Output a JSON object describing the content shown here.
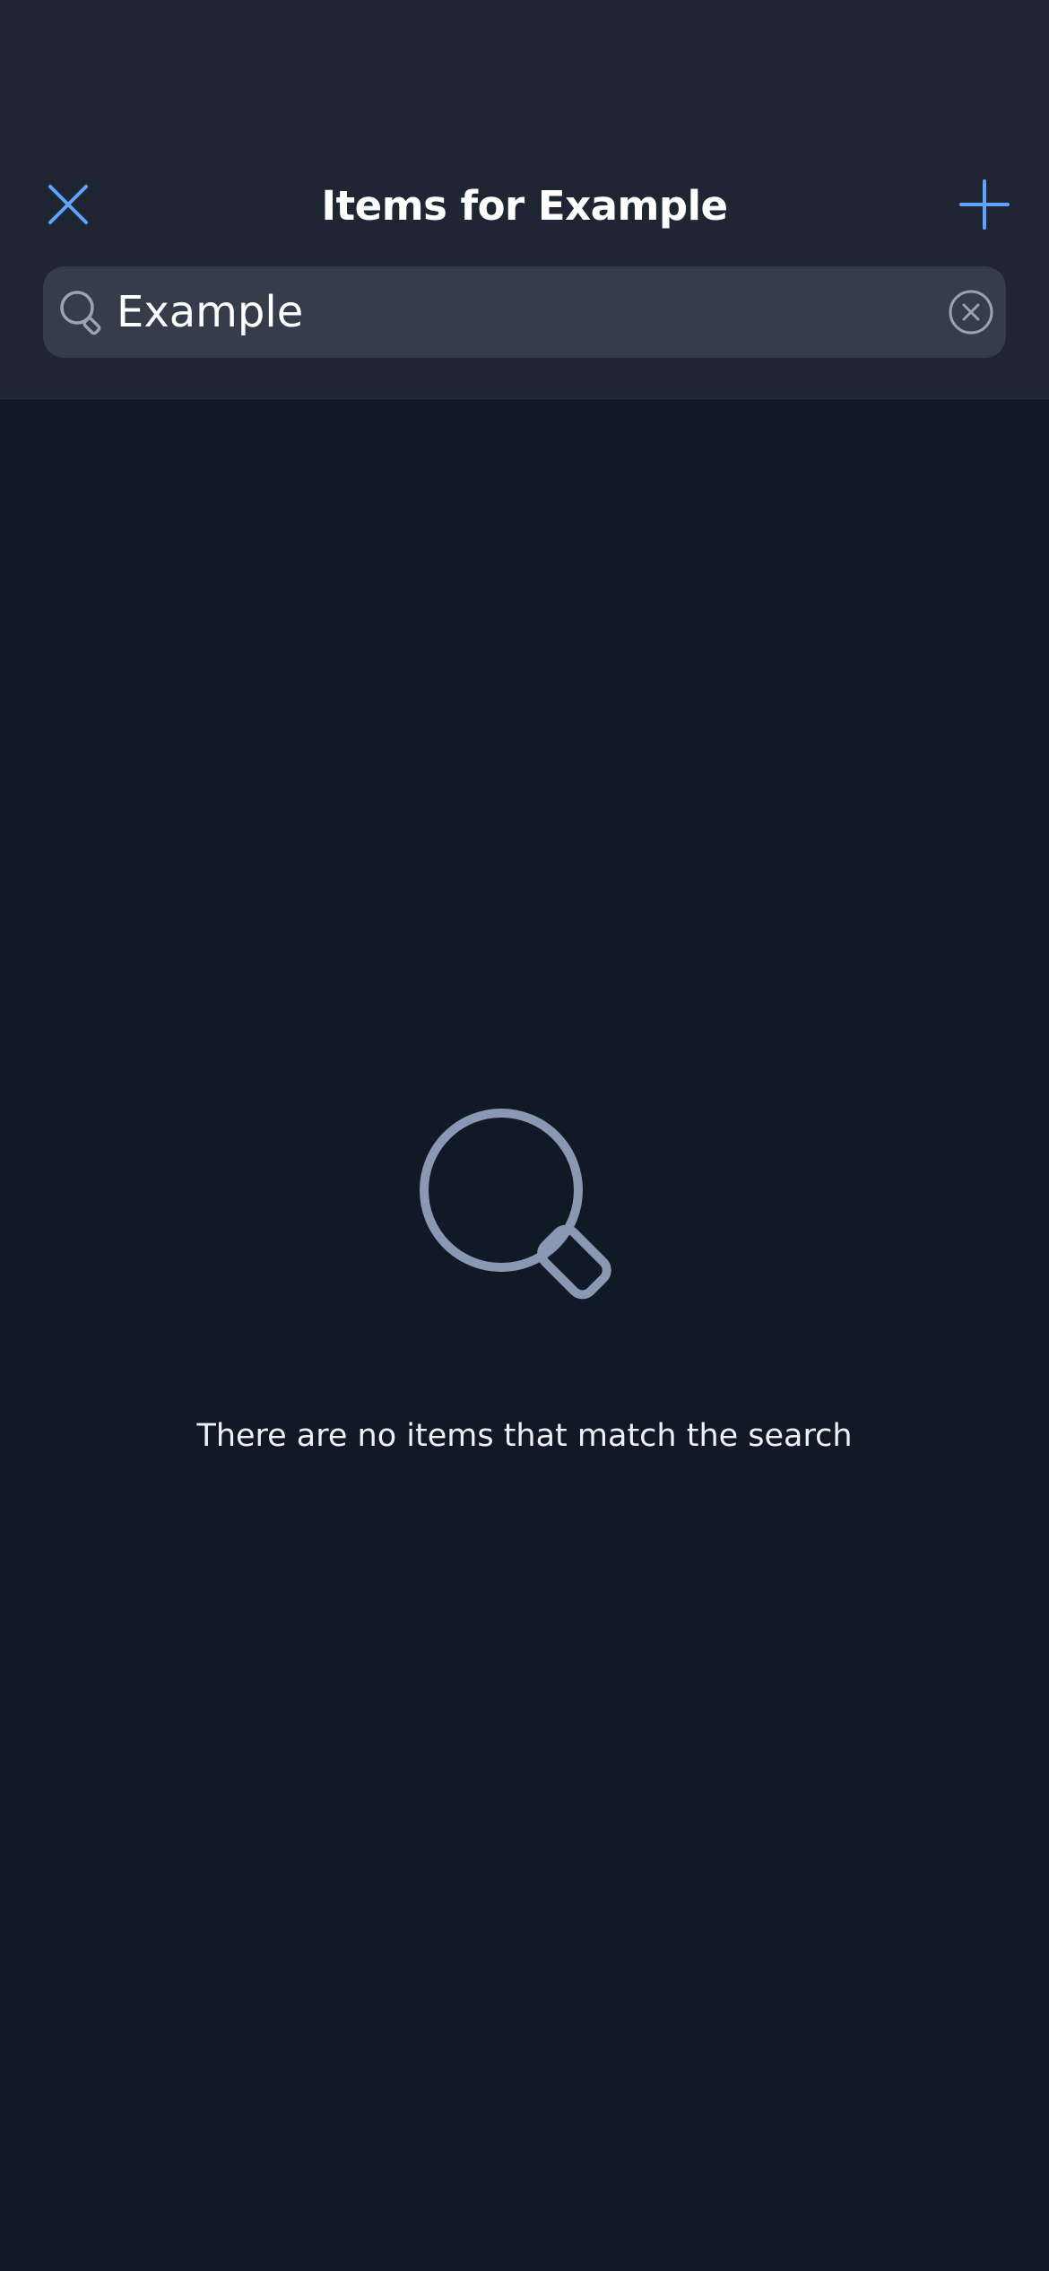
{
  "header": {
    "title": "Items for Example"
  },
  "search": {
    "value": "Example"
  },
  "empty_state": {
    "message": "There are no items that match the search"
  },
  "icons": {
    "close": "close-icon",
    "add": "plus-icon",
    "search": "search-icon",
    "clear": "clear-circle-icon",
    "empty": "magnifier-icon"
  },
  "colors": {
    "accent": "#5ea4ff",
    "header_bg": "#1f2532",
    "page_bg": "#121926",
    "search_bg": "#353c4a",
    "empty_icon": "#8a98b4"
  }
}
